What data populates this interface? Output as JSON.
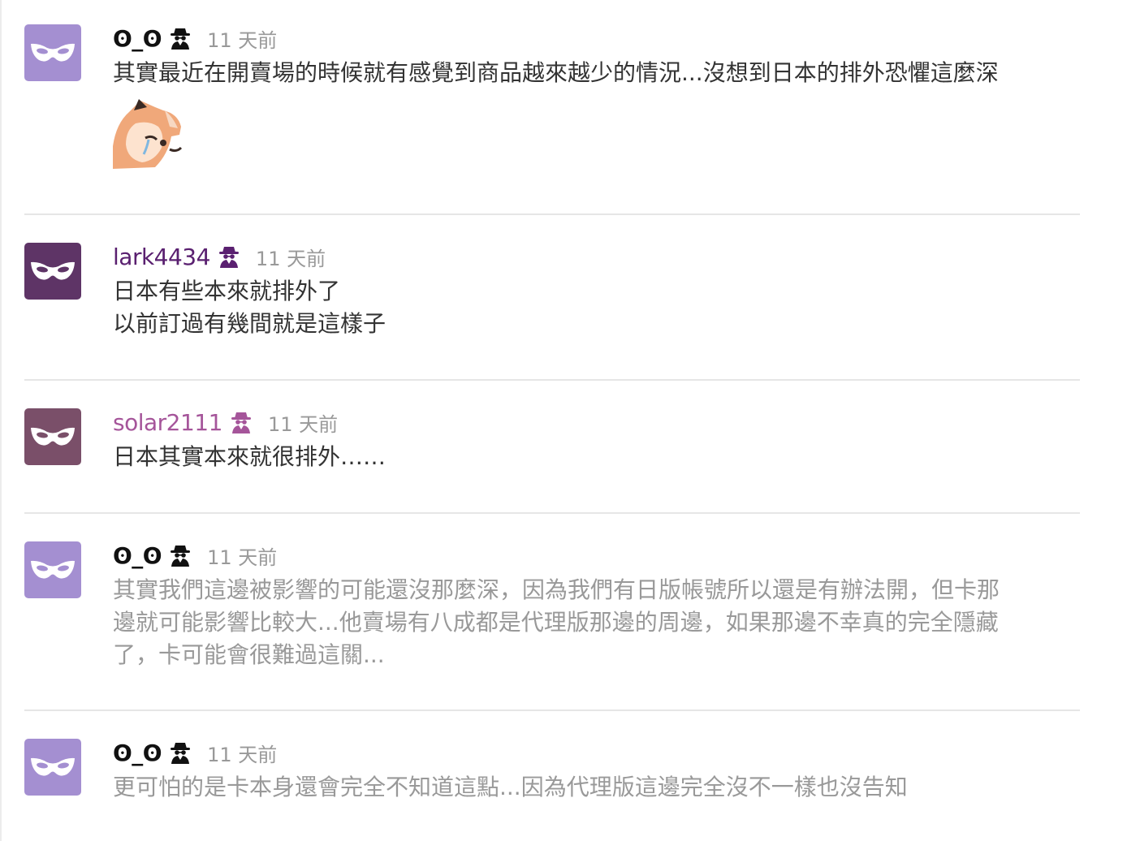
{
  "comments": [
    {
      "author": "ʘ_ʘ",
      "avatar_color": "#a48fd1",
      "author_color": "#111111",
      "badge_icon": "incognito-icon",
      "time": "11 天前",
      "text": "其實最近在開賣場的時候就有感覺到商品越來越少的情況...沒想到日本的排外恐懼這麼深",
      "sticker_icon": "crying-fox-sticker"
    },
    {
      "author": "lark4434",
      "avatar_color": "#5e3466",
      "author_color": "#5a2070",
      "badge_icon": "incognito-icon",
      "time": "11 天前",
      "text": "日本有些本來就排外了\n以前訂過有幾間就是這樣子"
    },
    {
      "author": "solar2111",
      "avatar_color": "#7a4f69",
      "author_color": "#a5559a",
      "badge_icon": "incognito-icon",
      "time": "11 天前",
      "text": "日本其實本來就很排外……"
    },
    {
      "author": "ʘ_ʘ",
      "avatar_color": "#a48fd1",
      "author_color": "#111111",
      "badge_icon": "incognito-icon",
      "time": "11 天前",
      "text": "其實我們這邊被影響的可能還沒那麼深，因為我們有日版帳號所以還是有辦法開，但卡那\n邊就可能影響比較大...他賣場有八成都是代理版那邊的周邊，如果那邊不幸真的完全隱藏\n了，卡可能會很難過這關..."
    },
    {
      "author": "ʘ_ʘ",
      "avatar_color": "#a48fd1",
      "author_color": "#111111",
      "badge_icon": "incognito-icon",
      "time": "11 天前",
      "text": "更可怕的是卡本身還會完全不知道這點...因為代理版這邊完全沒不一樣也沒告知"
    }
  ]
}
